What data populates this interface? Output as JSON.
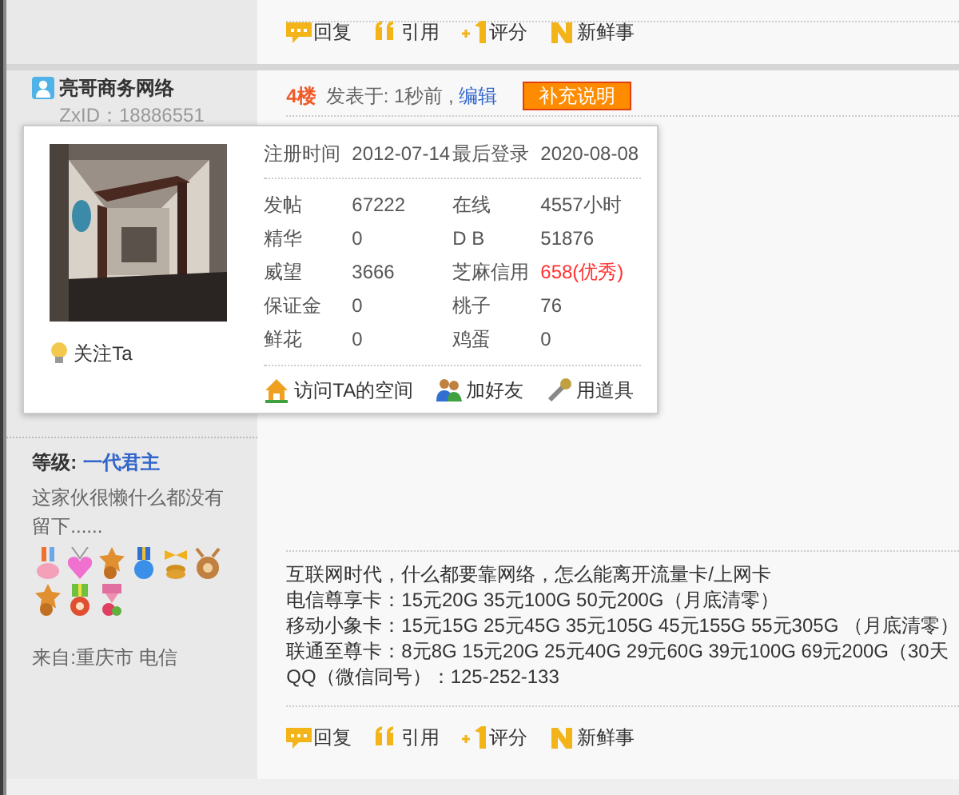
{
  "top_actions": [
    {
      "kind": "reply",
      "label": "回复"
    },
    {
      "kind": "quote",
      "label": "引用"
    },
    {
      "kind": "rate",
      "label": "评分"
    },
    {
      "kind": "news",
      "label": "新鲜事"
    }
  ],
  "post": {
    "author": "亮哥商务网络",
    "zxid": "ZxID：18886551",
    "floor": "4楼",
    "posted": "发表于: 1秒前 ,",
    "edit": "编辑",
    "supplement_button": "补充说明"
  },
  "profile_popup": {
    "registered_label": "注册时间",
    "registered": "2012-07-14",
    "last_login_label": "最后登录",
    "last_login": "2020-08-08",
    "follow": "关注Ta",
    "stats": [
      {
        "label": "发帖",
        "value": "67222",
        "highlight": false
      },
      {
        "label": "在线",
        "value": "4557小时",
        "highlight": false
      },
      {
        "label": "精华",
        "value": "0",
        "highlight": false
      },
      {
        "label": "D B",
        "value": "51876",
        "highlight": false
      },
      {
        "label": "威望",
        "value": "3666",
        "highlight": false
      },
      {
        "label": "芝麻信用",
        "value": "658(优秀)",
        "highlight": true
      },
      {
        "label": "保证金",
        "value": "0",
        "highlight": false
      },
      {
        "label": "桃子",
        "value": "76",
        "highlight": false
      },
      {
        "label": "鲜花",
        "value": "0",
        "highlight": false
      },
      {
        "label": "鸡蛋",
        "value": "0",
        "highlight": false
      }
    ],
    "links": [
      {
        "kind": "home",
        "label": "访问TA的空间"
      },
      {
        "kind": "friends",
        "label": "加好友"
      },
      {
        "kind": "tool",
        "label": "用道具"
      }
    ]
  },
  "sidebar": {
    "level_label": "等级:",
    "level": "一代君主",
    "bio": "这家伙很懒什么都没有留下......",
    "medals": [
      {
        "kind": "ribbon"
      },
      {
        "kind": "heart"
      },
      {
        "kind": "star"
      },
      {
        "kind": "rosette"
      },
      {
        "kind": "coins"
      },
      {
        "kind": "deer"
      },
      {
        "kind": "star"
      },
      {
        "kind": "flower"
      },
      {
        "kind": "hd"
      }
    ],
    "location": "来自:重庆市 电信"
  },
  "content": [
    "互联网时代，什么都要靠网络，怎么能离开流量卡/上网卡",
    "电信尊享卡：15元20G 35元100G 50元200G（月底清零）",
    "移动小象卡：15元15G 25元45G 35元105G 45元155G 55元305G （月底清零）",
    "联通至尊卡：8元8G 15元20G 25元40G 29元60G 39元100G 69元200G（30天",
    "QQ（微信同号）：125-252-133"
  ],
  "bottom_actions": [
    {
      "kind": "reply",
      "label": "回复"
    },
    {
      "kind": "quote",
      "label": "引用"
    },
    {
      "kind": "rate",
      "label": "评分"
    },
    {
      "kind": "news",
      "label": "新鲜事"
    }
  ]
}
